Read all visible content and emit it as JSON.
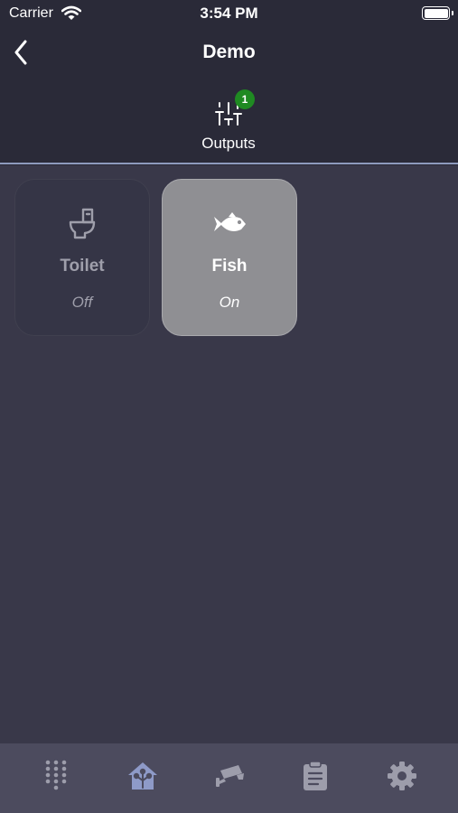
{
  "status_bar": {
    "carrier": "Carrier",
    "time": "3:54 PM"
  },
  "nav": {
    "title": "Demo",
    "back_icon": "chevron-left-icon"
  },
  "tabs": [
    {
      "label": "Outputs",
      "icon": "sliders-icon",
      "badge": "1",
      "badge_color": "#1f8a22",
      "selected": true
    }
  ],
  "tiles": [
    {
      "name": "Toilet",
      "state": "Off",
      "icon": "toilet-icon",
      "on": false
    },
    {
      "name": "Fish",
      "state": "On",
      "icon": "fish-icon",
      "on": true
    }
  ],
  "tab_bar": {
    "items": [
      {
        "icon": "keypad-icon",
        "active": false
      },
      {
        "icon": "home-network-icon",
        "active": true
      },
      {
        "icon": "security-camera-icon",
        "active": false
      },
      {
        "icon": "clipboard-icon",
        "active": false
      },
      {
        "icon": "gear-icon",
        "active": false
      }
    ]
  },
  "colors": {
    "background": "#393849",
    "header": "#2a2a38",
    "accent_line": "#8e9abd",
    "tab_bar": "#4c4b5e",
    "tab_icon_inactive": "#9d9dab",
    "tab_icon_active": "#8e9ac8",
    "tile_on": "#8f8f93",
    "tile_off": "#353546"
  }
}
